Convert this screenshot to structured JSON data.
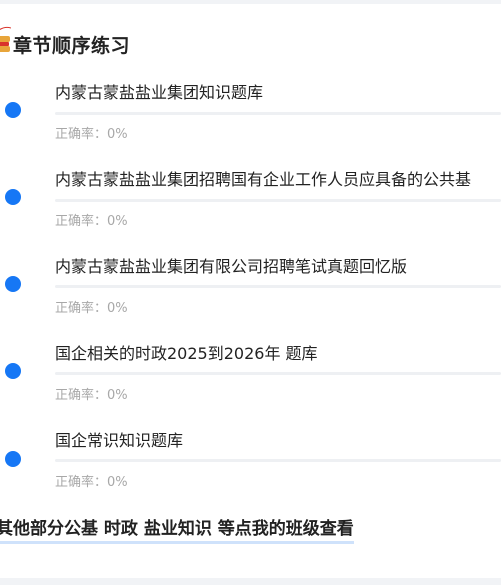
{
  "section": {
    "title": "章节顺序练习",
    "icon": "badge-icon"
  },
  "chapters": [
    {
      "title": "内蒙古蒙盐盐业集团知识题库",
      "accuracy": "正确率：0%",
      "progress": 0
    },
    {
      "title": "内蒙古蒙盐盐业集团招聘国有企业工作人员应具备的公共基",
      "accuracy": "正确率：0%",
      "progress": 0
    },
    {
      "title": "内蒙古蒙盐盐业集团有限公司招聘笔试真题回忆版",
      "accuracy": "正确率：0%",
      "progress": 0
    },
    {
      "title": "国企相关的时政2025到2026年 题库",
      "accuracy": "正确率：0%",
      "progress": 0
    },
    {
      "title": "国企常识知识题库",
      "accuracy": "正确率：0%",
      "progress": 0
    }
  ],
  "footer": {
    "link_text": "其他部分公基 时政 盐业知识 等点我的班级查看"
  },
  "colors": {
    "accent": "#1677f5",
    "background": "#f1f3f6",
    "text": "#222222",
    "muted": "#a8a8a8"
  }
}
